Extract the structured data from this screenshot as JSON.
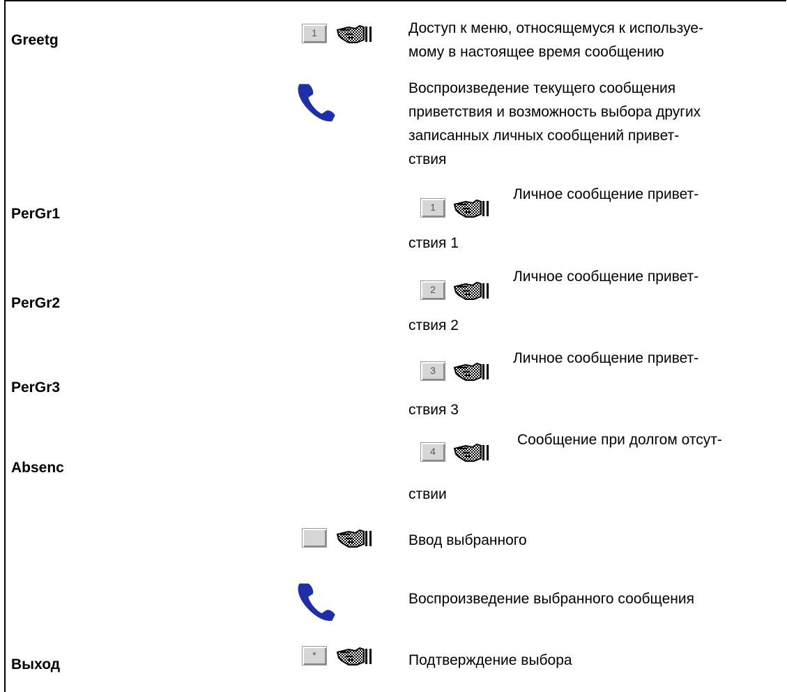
{
  "rows": {
    "greetg": {
      "label": "Greetg",
      "key": "1",
      "text_line1": "Доступ к меню, относящемуся к используе-",
      "text_line2": "мому в настоящее время сообщению"
    },
    "play_current": {
      "line1": "Воспроизведение текущего сообщения",
      "line2": "приветствия и возможность выбора других",
      "line3": "записанных личных сообщений привет-",
      "line4": "ствия"
    },
    "pergr1": {
      "label": "PerGr1",
      "key": "1",
      "text": "Личное сообщение привет-",
      "text_cont": "ствия 1"
    },
    "pergr2": {
      "label": "PerGr2",
      "key": "2",
      "text": "Личное сообщение привет-",
      "text_cont": "ствия 2"
    },
    "pergr3": {
      "label": "PerGr3",
      "key": "3",
      "text": "Личное сообщение привет-",
      "text_cont": "ствия 3"
    },
    "absenc": {
      "label": "Absenc",
      "key": "4",
      "text": "Сообщение при долгом отсут-",
      "text_cont": "ствии"
    },
    "enter": {
      "key": "",
      "text": "Ввод выбранного"
    },
    "play_selected": {
      "text": "Воспроизведение выбранного сообщения"
    },
    "exit": {
      "label": "Выход",
      "key": "*",
      "text": "Подтверждение выбора"
    }
  },
  "icons": {
    "hand": "pointing-hand-icon",
    "phone": "handset-icon",
    "key": "keypad-key-icon"
  },
  "colors": {
    "phone": "#1f2fa8",
    "key_face": "#d6d6d6"
  }
}
